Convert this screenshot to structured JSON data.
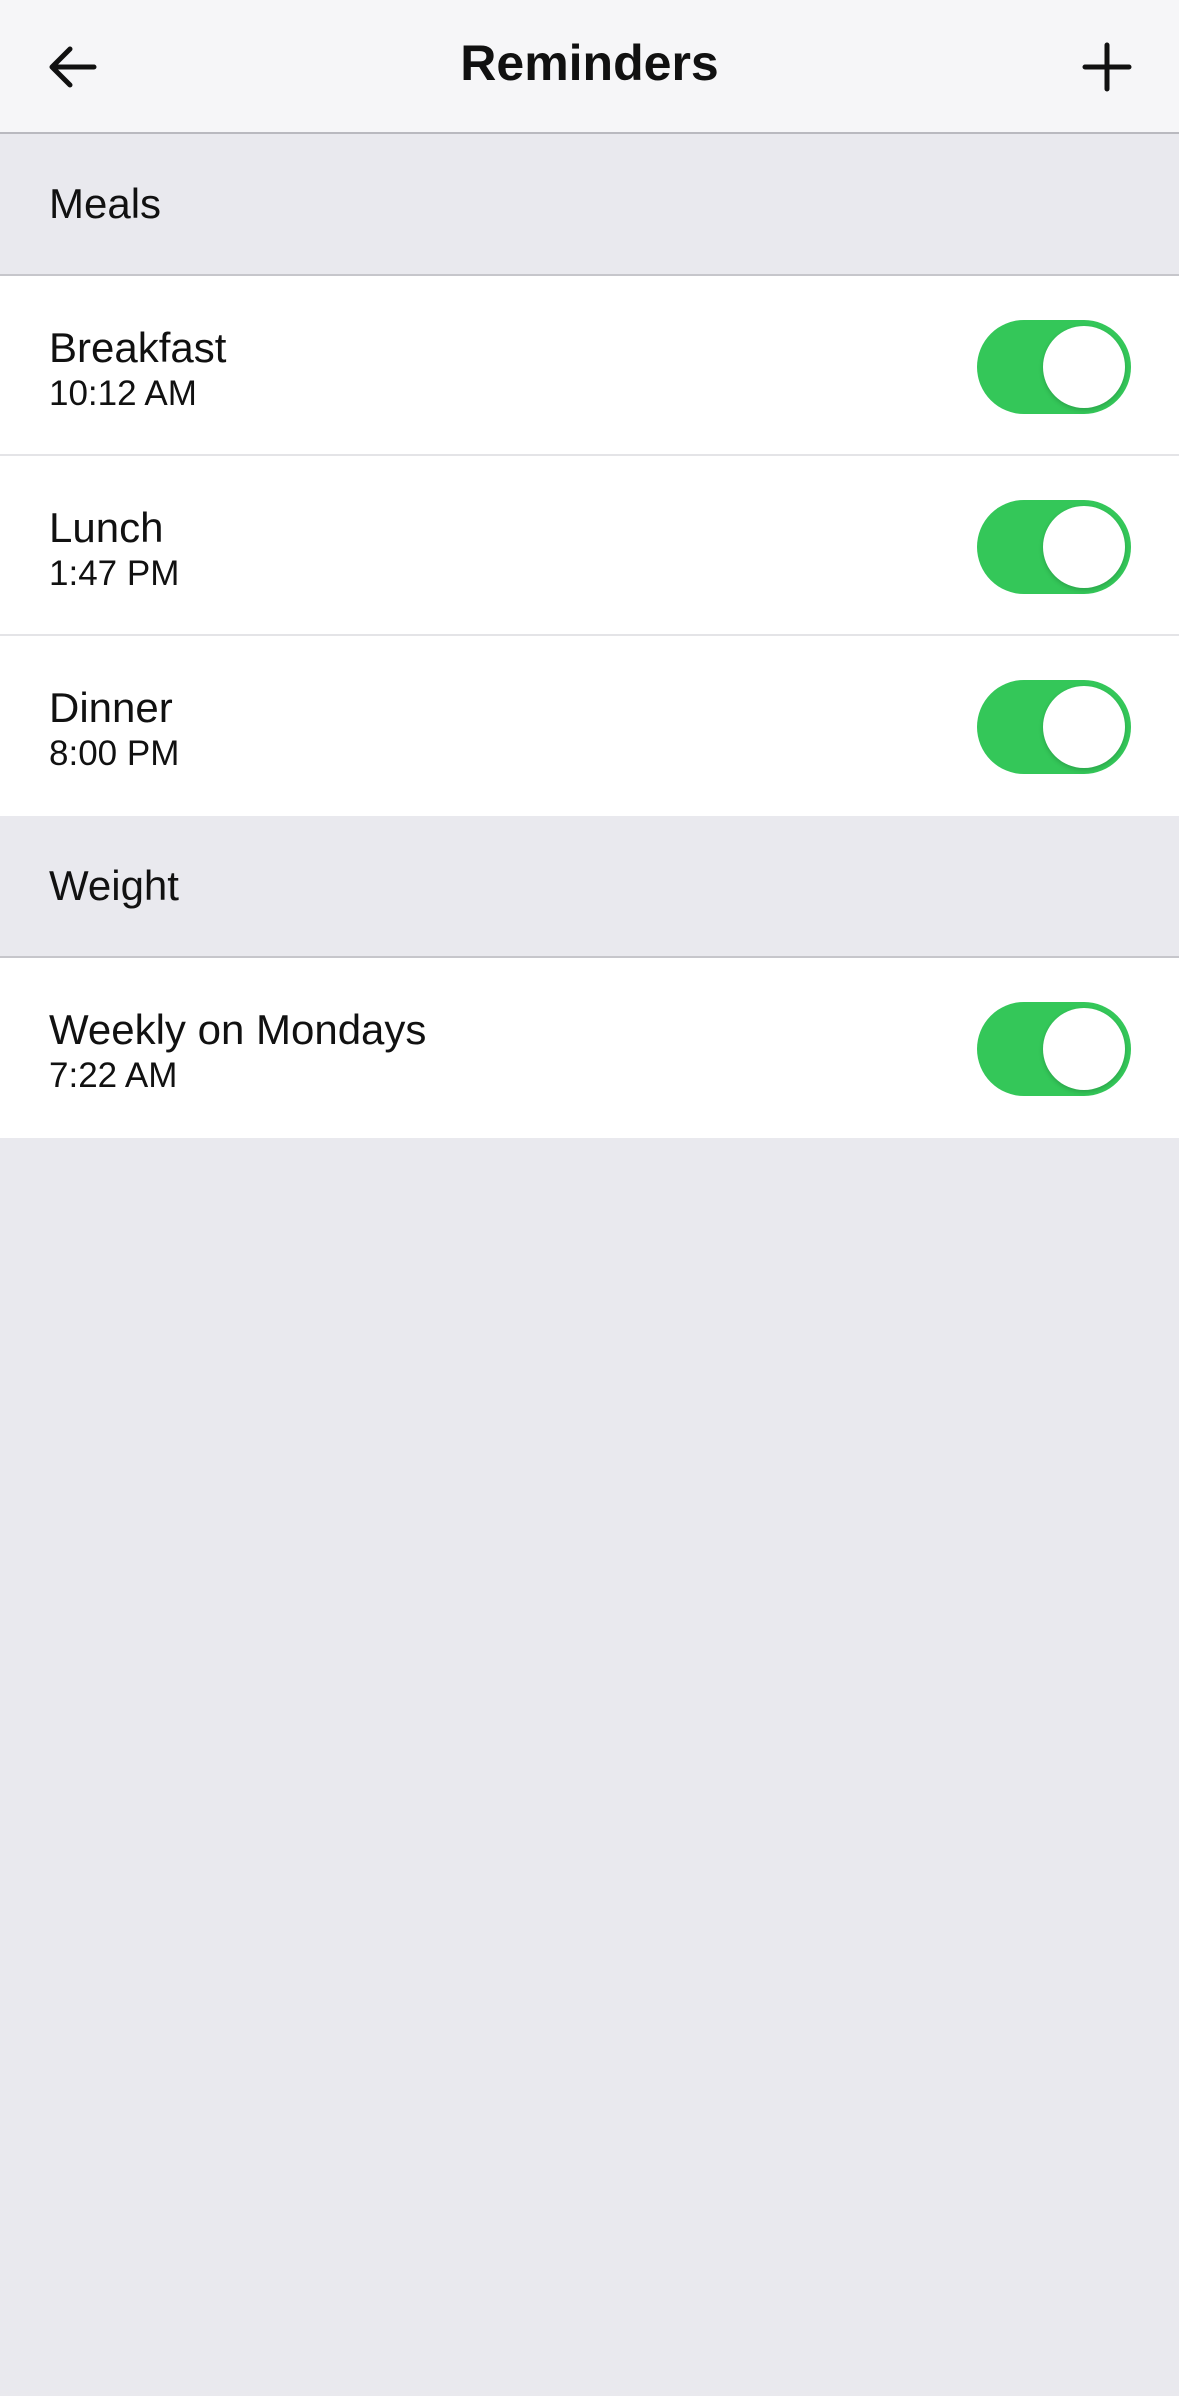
{
  "header": {
    "title": "Reminders",
    "back_icon": "arrow-left-icon",
    "add_icon": "plus-icon"
  },
  "sections": [
    {
      "label": "Meals",
      "items": [
        {
          "title": "Breakfast",
          "time": "10:12 AM",
          "enabled": true
        },
        {
          "title": "Lunch",
          "time": "1:47 PM",
          "enabled": true
        },
        {
          "title": "Dinner",
          "time": "8:00 PM",
          "enabled": true
        }
      ]
    },
    {
      "label": "Weight",
      "items": [
        {
          "title": "Weekly on Mondays",
          "time": "7:22 AM",
          "enabled": true
        }
      ]
    }
  ],
  "colors": {
    "toggle_on": "#34c759",
    "background": "#e9e9ee",
    "navbar": "#f6f6f8"
  }
}
